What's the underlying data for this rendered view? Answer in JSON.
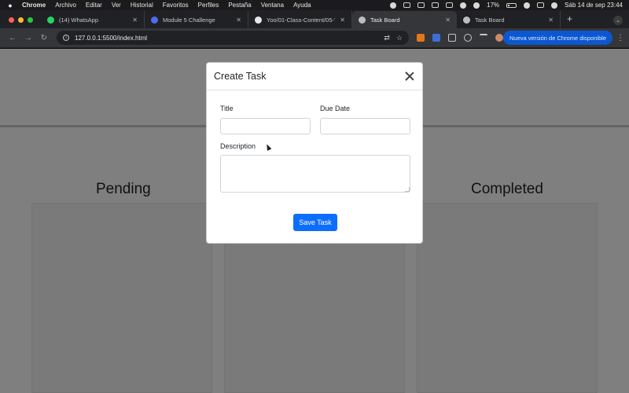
{
  "menubar": {
    "app_name": "Chrome",
    "items": [
      "Archivo",
      "Editar",
      "Ver",
      "Historial",
      "Favoritos",
      "Perfiles",
      "Pestaña",
      "Ventana",
      "Ayuda"
    ],
    "battery": "17%",
    "datetime": "Sáb 14 de sep  23:44"
  },
  "tabs": [
    {
      "label": "(14) WhatsApp",
      "icon": "whatsapp-icon",
      "color": "#25d366"
    },
    {
      "label": "Module 5 Challenge",
      "icon": "module-icon",
      "color": "#4f6bed"
    },
    {
      "label": "Yoo/01-Class-Content/05-Th",
      "icon": "github-icon",
      "color": "#e8e8e8"
    },
    {
      "label": "Task Board",
      "icon": "globe-icon",
      "color": "#bdbdbd",
      "active": true
    },
    {
      "label": "Task Board",
      "icon": "globe-icon",
      "color": "#bdbdbd"
    }
  ],
  "toolbar": {
    "url": "127.0.0.1:5500/index.html",
    "update_label": "Nueva versión de Chrome disponible"
  },
  "page": {
    "columns": [
      "Pending",
      "Completed"
    ]
  },
  "modal": {
    "title": "Create Task",
    "title_label": "Title",
    "due_date_label": "Due Date",
    "description_label": "Description",
    "title_value": "",
    "due_date_value": "",
    "description_value": "",
    "save_label": "Save Task"
  },
  "colors": {
    "primary_button": "#0d6efd",
    "update_pill": "#0b57d0"
  }
}
